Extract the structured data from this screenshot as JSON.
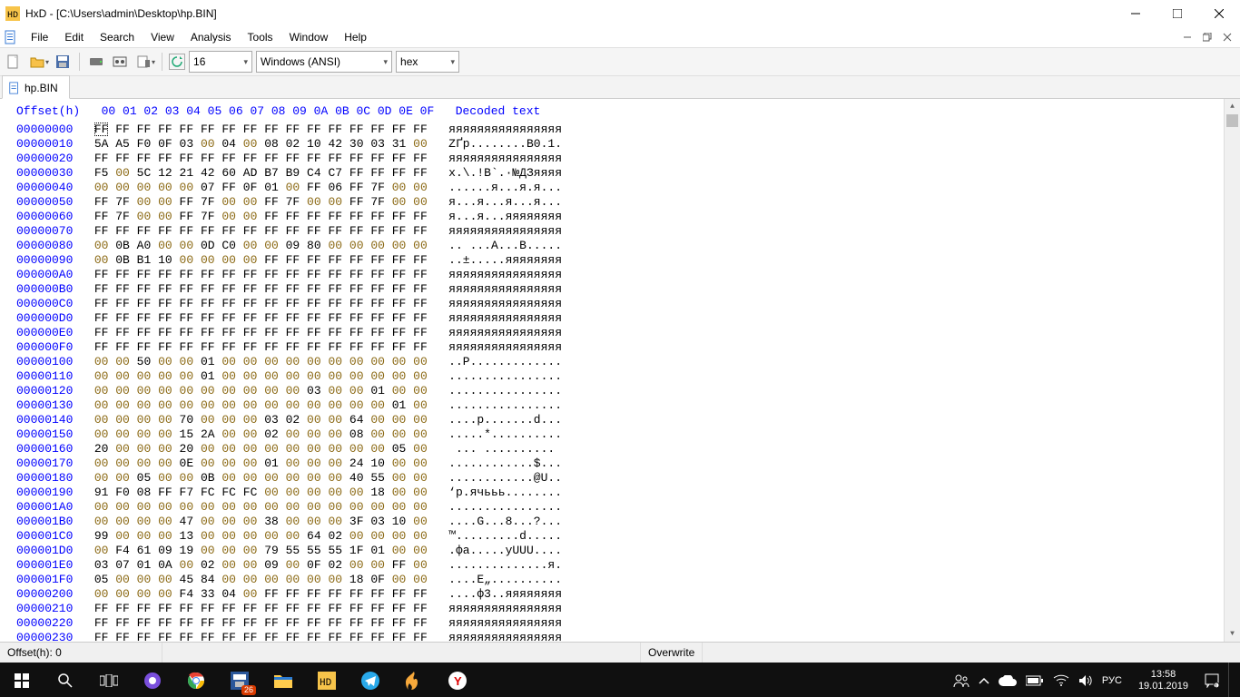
{
  "window": {
    "title": "HxD - [C:\\Users\\admin\\Desktop\\hp.BIN]"
  },
  "menu": {
    "items": [
      "File",
      "Edit",
      "Search",
      "View",
      "Analysis",
      "Tools",
      "Window",
      "Help"
    ]
  },
  "toolbar": {
    "columns_value": "16",
    "encoding_value": "Windows (ANSI)",
    "base_value": "hex"
  },
  "tab": {
    "label": "hp.BIN"
  },
  "hex": {
    "header_offset": "Offset(h)",
    "header_cols": "00 01 02 03 04 05 06 07 08 09 0A 0B 0C 0D 0E 0F",
    "header_decoded": "Decoded text",
    "rows": [
      {
        "off": "00000000",
        "hex": "FF FF FF FF FF FF FF FF FF FF FF FF FF FF FF FF",
        "txt": "яяяяяяяяяяяяяяяя"
      },
      {
        "off": "00000010",
        "hex": "5A A5 F0 0F 03 00 04 00 08 02 10 42 30 03 31 00",
        "txt": "ZҐр........B0.1."
      },
      {
        "off": "00000020",
        "hex": "FF FF FF FF FF FF FF FF FF FF FF FF FF FF FF FF",
        "txt": "яяяяяяяяяяяяяяяя"
      },
      {
        "off": "00000030",
        "hex": "F5 00 5C 12 21 42 60 AD B7 B9 C4 C7 FF FF FF FF",
        "txt": "х.\\.!B`.·№ДЗяяяя"
      },
      {
        "off": "00000040",
        "hex": "00 00 00 00 00 07 FF 0F 01 00 FF 06 FF 7F 00 00",
        "txt": "......я...я.я..."
      },
      {
        "off": "00000050",
        "hex": "FF 7F 00 00 FF 7F 00 00 FF 7F 00 00 FF 7F 00 00",
        "txt": "я...я...я...я..."
      },
      {
        "off": "00000060",
        "hex": "FF 7F 00 00 FF 7F 00 00 FF FF FF FF FF FF FF FF",
        "txt": "я...я...яяяяяяяя"
      },
      {
        "off": "00000070",
        "hex": "FF FF FF FF FF FF FF FF FF FF FF FF FF FF FF FF",
        "txt": "яяяяяяяяяяяяяяяя"
      },
      {
        "off": "00000080",
        "hex": "00 0B A0 00 00 0D C0 00 00 09 80 00 00 00 00 00",
        "txt": ".. ...А...В....."
      },
      {
        "off": "00000090",
        "hex": "00 0B B1 10 00 00 00 00 FF FF FF FF FF FF FF FF",
        "txt": "..±.....яяяяяяяя"
      },
      {
        "off": "000000A0",
        "hex": "FF FF FF FF FF FF FF FF FF FF FF FF FF FF FF FF",
        "txt": "яяяяяяяяяяяяяяяя"
      },
      {
        "off": "000000B0",
        "hex": "FF FF FF FF FF FF FF FF FF FF FF FF FF FF FF FF",
        "txt": "яяяяяяяяяяяяяяяя"
      },
      {
        "off": "000000C0",
        "hex": "FF FF FF FF FF FF FF FF FF FF FF FF FF FF FF FF",
        "txt": "яяяяяяяяяяяяяяяя"
      },
      {
        "off": "000000D0",
        "hex": "FF FF FF FF FF FF FF FF FF FF FF FF FF FF FF FF",
        "txt": "яяяяяяяяяяяяяяяя"
      },
      {
        "off": "000000E0",
        "hex": "FF FF FF FF FF FF FF FF FF FF FF FF FF FF FF FF",
        "txt": "яяяяяяяяяяяяяяяя"
      },
      {
        "off": "000000F0",
        "hex": "FF FF FF FF FF FF FF FF FF FF FF FF FF FF FF FF",
        "txt": "яяяяяяяяяяяяяяяя"
      },
      {
        "off": "00000100",
        "hex": "00 00 50 00 00 01 00 00 00 00 00 00 00 00 00 00",
        "txt": "..P............."
      },
      {
        "off": "00000110",
        "hex": "00 00 00 00 00 01 00 00 00 00 00 00 00 00 00 00",
        "txt": "................"
      },
      {
        "off": "00000120",
        "hex": "00 00 00 00 00 00 00 00 00 00 03 00 00 01 00 00",
        "txt": "................"
      },
      {
        "off": "00000130",
        "hex": "00 00 00 00 00 00 00 00 00 00 00 00 00 00 01 00",
        "txt": "................"
      },
      {
        "off": "00000140",
        "hex": "00 00 00 00 70 00 00 00 03 02 00 00 64 00 00 00",
        "txt": "....p.......d..."
      },
      {
        "off": "00000150",
        "hex": "00 00 00 00 15 2A 00 00 02 00 00 00 08 00 00 00",
        "txt": ".....*.........."
      },
      {
        "off": "00000160",
        "hex": "20 00 00 00 20 00 00 00 00 00 00 00 00 00 05 00",
        "txt": " ... .........."
      },
      {
        "off": "00000170",
        "hex": "00 00 00 00 0E 00 00 00 01 00 00 00 24 10 00 00",
        "txt": "............$..."
      },
      {
        "off": "00000180",
        "hex": "00 00 05 00 00 0B 00 00 00 00 00 00 40 55 00 00",
        "txt": "............@U.."
      },
      {
        "off": "00000190",
        "hex": "91 F0 08 FF F7 FC FC FC 00 00 00 00 00 18 00 00",
        "txt": "‘р.ячььь........"
      },
      {
        "off": "000001A0",
        "hex": "00 00 00 00 00 00 00 00 00 00 00 00 00 00 00 00",
        "txt": "................"
      },
      {
        "off": "000001B0",
        "hex": "00 00 00 00 47 00 00 00 38 00 00 00 3F 03 10 00",
        "txt": "....G...8...?..."
      },
      {
        "off": "000001C0",
        "hex": "99 00 00 00 13 00 00 00 00 00 64 02 00 00 00 00",
        "txt": "™.........d....."
      },
      {
        "off": "000001D0",
        "hex": "00 F4 61 09 19 00 00 00 79 55 55 55 1F 01 00 00",
        "txt": ".фa.....yUUU...."
      },
      {
        "off": "000001E0",
        "hex": "03 07 01 0A 00 02 00 00 09 00 0F 02 00 00 FF 00",
        "txt": "..............я."
      },
      {
        "off": "000001F0",
        "hex": "05 00 00 00 45 84 00 00 00 00 00 00 18 0F 00 00",
        "txt": "....Е„.........."
      },
      {
        "off": "00000200",
        "hex": "00 00 00 00 F4 33 04 00 FF FF FF FF FF FF FF FF",
        "txt": "....ф3..яяяяяяяя"
      },
      {
        "off": "00000210",
        "hex": "FF FF FF FF FF FF FF FF FF FF FF FF FF FF FF FF",
        "txt": "яяяяяяяяяяяяяяяя"
      },
      {
        "off": "00000220",
        "hex": "FF FF FF FF FF FF FF FF FF FF FF FF FF FF FF FF",
        "txt": "яяяяяяяяяяяяяяяя"
      },
      {
        "off": "00000230",
        "hex": "FF FF FF FF FF FF FF FF FF FF FF FF FF FF FF FF",
        "txt": "яяяяяяяяяяяяяяяя"
      }
    ]
  },
  "status": {
    "offset_label": "Offset(h): 0",
    "mode": "Overwrite"
  },
  "taskbar": {
    "clock_time": "13:58",
    "clock_date": "19.01.2019",
    "lang": "РУС",
    "badge_save": "26"
  }
}
